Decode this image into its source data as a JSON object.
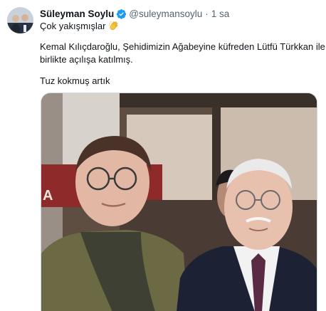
{
  "author": {
    "display_name": "Süleyman Soylu",
    "handle": "@suleymansoylu",
    "separator": "·",
    "time": "1 sa",
    "avatar_icon": "profile-photo",
    "verified_icon": "verified-badge-icon"
  },
  "tweet": {
    "line1": "Çok yakışmışlar",
    "line1_emoji": "clapping-hands-icon",
    "line2": "Kemal Kılıçdaroğlu, Şehidimizin Ağabeyine küfreden Lütfü Türkkan ile",
    "line3": "birlikte açılışa katılmış.",
    "line4": "Tuz kokmuş artık"
  },
  "media": {
    "type": "photo",
    "description_icon": "photo-two-men"
  },
  "colors": {
    "accent": "#1d9bf0",
    "text": "#0f1419",
    "secondary": "#536471",
    "border": "#cfd9de"
  }
}
